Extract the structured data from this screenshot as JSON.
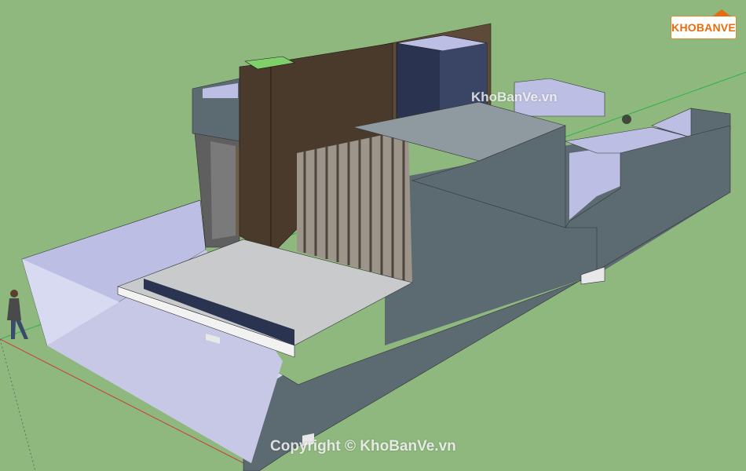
{
  "scene": {
    "background_color": "#8fb87e",
    "main_wall_color": "#5c6a72",
    "interior_wall_color": "#bcbfe3",
    "floor_color": "#c9cacc",
    "wood_panel_color": "#4a3a2c",
    "window_box_color": "#2a3350",
    "fin_color": "#a39a8f"
  },
  "logo": {
    "text": "KHOBANVE"
  },
  "watermark": {
    "text": "KhoBanVe.vn"
  },
  "copyright": {
    "text": "Copyright © KhoBanVe.vn"
  },
  "person": {
    "label": ""
  }
}
